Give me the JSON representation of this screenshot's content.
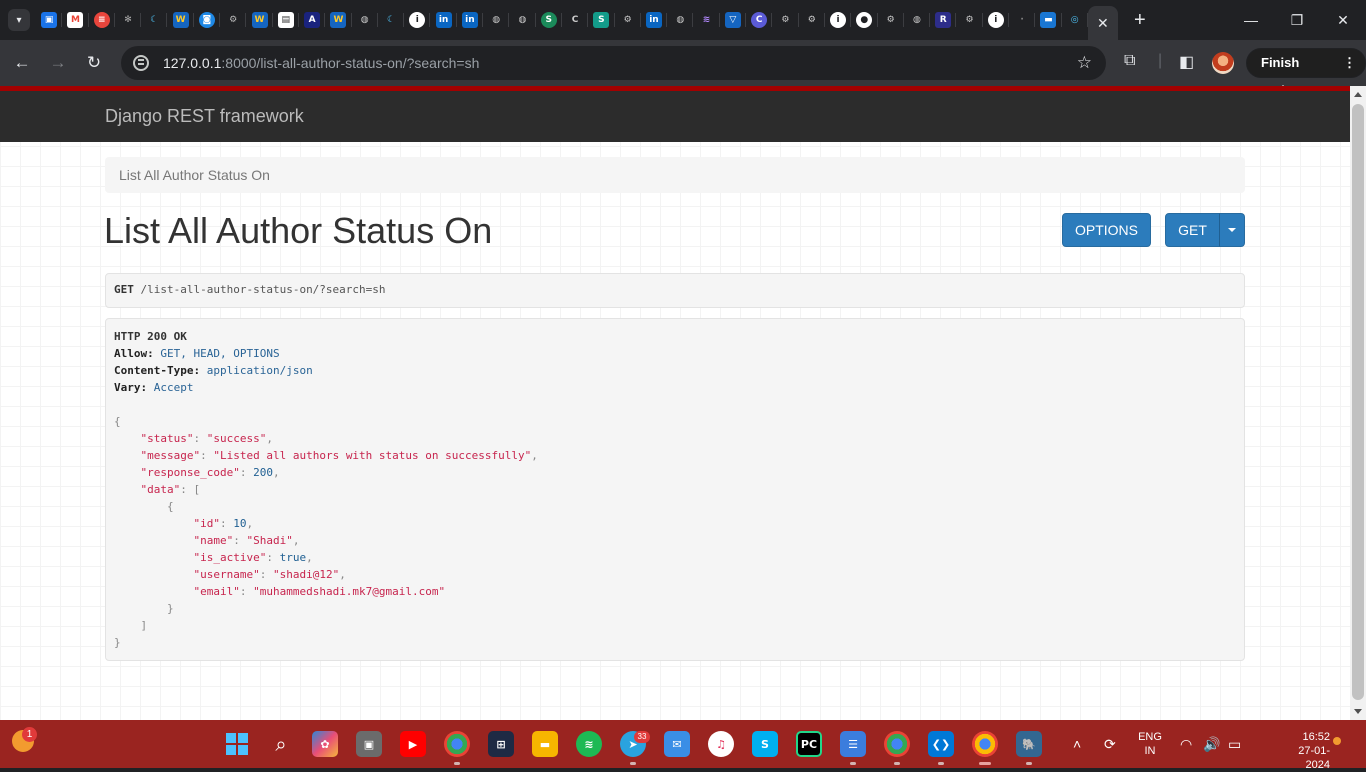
{
  "browser": {
    "tab_count_visible": 41,
    "active_tab_close": "✕",
    "new_tab": "+",
    "url_host": "127.0.0.1",
    "url_rest": ":8000/list-all-author-status-on/?search=sh",
    "finish_update_label": "Finish update",
    "window_controls": {
      "minimize": "—",
      "maximize": "❐",
      "close": "✕"
    }
  },
  "page": {
    "brand": "Django REST framework",
    "breadcrumb": "List All Author Status On",
    "title": "List All Author Status On",
    "options_button": "OPTIONS",
    "get_button": "GET",
    "request_method": "GET",
    "request_path": "/list-all-author-status-on/?search=sh",
    "response": {
      "status_line": "HTTP 200 OK",
      "headers": [
        {
          "name": "Allow",
          "value": "GET, HEAD, OPTIONS"
        },
        {
          "name": "Content-Type",
          "value": "application/json"
        },
        {
          "name": "Vary",
          "value": "Accept"
        }
      ],
      "body": {
        "status": "success",
        "message": "Listed all authors with status on successfully",
        "response_code": "200",
        "data": [
          {
            "id": "10",
            "name": "Shadi",
            "is_active": "true",
            "username": "shadi@12",
            "email": "muhammedshadi.mk7@gmail.com"
          }
        ]
      }
    }
  },
  "taskbar": {
    "weather_badge": "1",
    "telegram_badge": "33",
    "lang_top": "ENG",
    "lang_bottom": "IN",
    "time": "16:52",
    "date": "27-01-2024"
  },
  "colors": {
    "drf_navbar": "#2c2c2c",
    "drf_accent": "#a30000",
    "button": "#2c7cbc",
    "taskbar": "#9a2420"
  }
}
